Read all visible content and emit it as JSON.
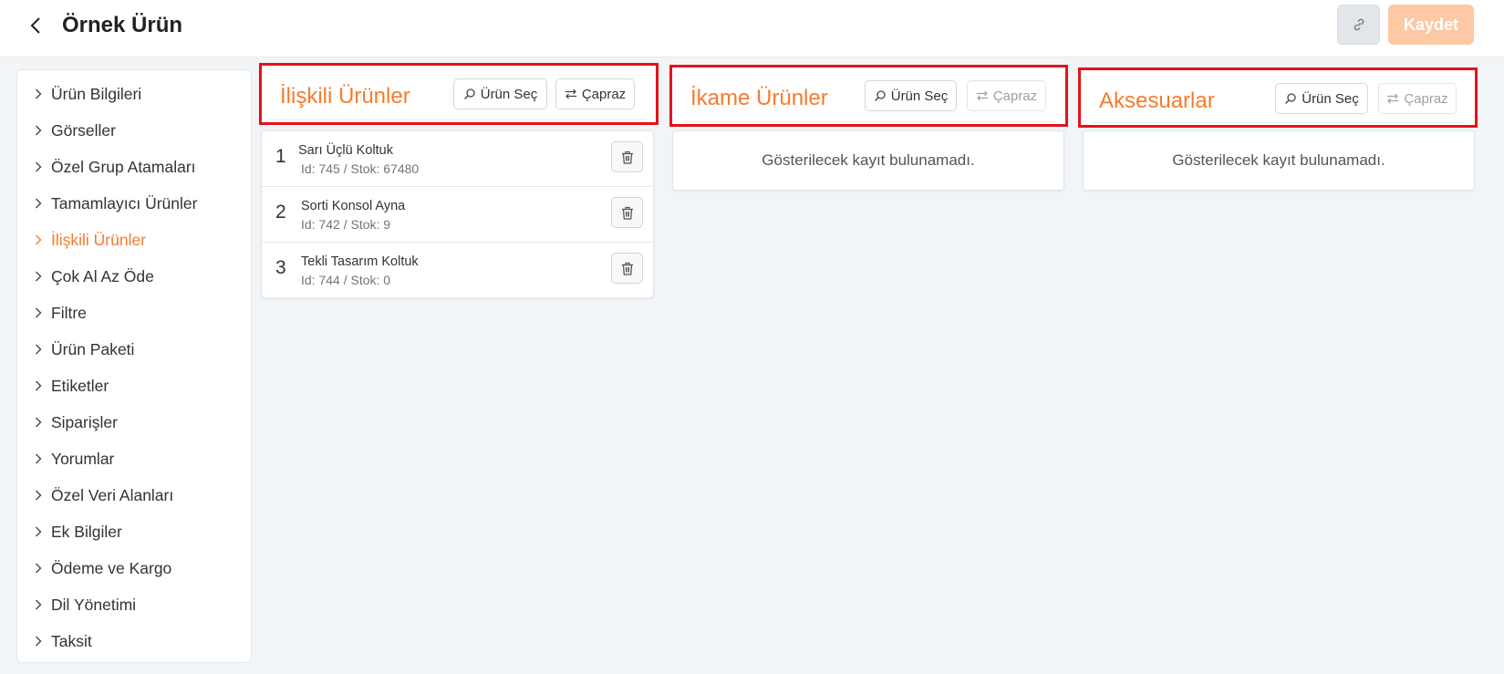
{
  "header": {
    "title": "Örnek Ürün",
    "back_icon": "chevron-left-icon",
    "link_icon": "link-icon",
    "save_label": "Kaydet"
  },
  "sidebar": {
    "items": [
      {
        "label": "Ürün Bilgileri",
        "active": false
      },
      {
        "label": "Görseller",
        "active": false
      },
      {
        "label": "Özel Grup Atamaları",
        "active": false
      },
      {
        "label": "Tamamlayıcı Ürünler",
        "active": false
      },
      {
        "label": "İlişkili Ürünler",
        "active": true
      },
      {
        "label": "Çok Al Az Öde",
        "active": false
      },
      {
        "label": "Filtre",
        "active": false
      },
      {
        "label": "Ürün Paketi",
        "active": false
      },
      {
        "label": "Etiketler",
        "active": false
      },
      {
        "label": "Siparişler",
        "active": false
      },
      {
        "label": "Yorumlar",
        "active": false
      },
      {
        "label": "Özel Veri Alanları",
        "active": false
      },
      {
        "label": "Ek Bilgiler",
        "active": false
      },
      {
        "label": "Ödeme ve Kargo",
        "active": false
      },
      {
        "label": "Dil Yönetimi",
        "active": false
      },
      {
        "label": "Taksit",
        "active": false
      }
    ]
  },
  "panels": [
    {
      "title": "İlişkili Ürünler",
      "select_label": "Ürün Seç",
      "cross_label": "Çapraz",
      "cross_enabled": true,
      "items": [
        {
          "num": "1",
          "name": "Sarı Üçlü Koltuk",
          "meta": "Id: 745 / Stok: 67480"
        },
        {
          "num": "2",
          "name": "Sorti Konsol Ayna",
          "meta": "Id: 742 / Stok: 9"
        },
        {
          "num": "3",
          "name": "Tekli Tasarım Koltuk",
          "meta": "Id: 744 / Stok: 0"
        }
      ]
    },
    {
      "title": "İkame Ürünler",
      "select_label": "Ürün Seç",
      "cross_label": "Çapraz",
      "cross_enabled": false,
      "empty_text": "Gösterilecek kayıt bulunamadı."
    },
    {
      "title": "Aksesuarlar",
      "select_label": "Ürün Seç",
      "cross_label": "Çapraz",
      "cross_enabled": false,
      "empty_text": "Gösterilecek kayıt bulunamadı."
    }
  ],
  "colors": {
    "accent": "#f77b2c",
    "highlight_border": "#e4121b",
    "save_button_bg": "#fcc9a4"
  }
}
